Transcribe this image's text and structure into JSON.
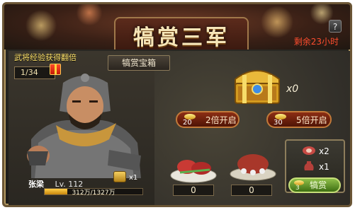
{
  "header": {
    "title": "犒赏三军",
    "help_icon": "question-mark-icon",
    "help_label": "?",
    "remaining": "剩余23小时"
  },
  "left": {
    "bonus_label": "武将经验获得翻倍",
    "counter": "1/34",
    "gift_icon": "gift-box-icon",
    "general_name": "张梁",
    "level": "Lv. 112",
    "exp_text": "312万/1327万",
    "exp_progress": 0.235,
    "small_chest_count": "x1"
  },
  "main": {
    "tab_label": "犒赏宝箱",
    "chest_icon": "treasure-chest-icon",
    "chest_count": "x0",
    "buttons": [
      {
        "cost": "20",
        "label": "2倍开启"
      },
      {
        "cost": "30",
        "label": "5倍开启"
      }
    ],
    "dishes": [
      {
        "icon": "meat-plate-icon",
        "count": "0"
      },
      {
        "icon": "roast-plate-icon",
        "count": "0"
      }
    ]
  },
  "reward": {
    "items": [
      {
        "icon": "meat-icon",
        "count": "x2"
      },
      {
        "icon": "wine-jar-icon",
        "count": "x1"
      }
    ],
    "button_cost": "3",
    "button_label": "犒赏"
  },
  "colors": {
    "remaining": "#ff4d2e",
    "bonus": "#ffe36a",
    "title": "#f6e6b8",
    "green_button": "#3d6e12"
  }
}
